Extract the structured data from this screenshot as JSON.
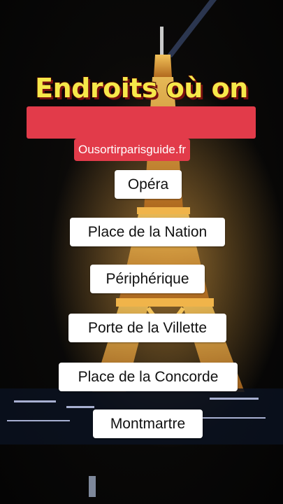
{
  "overlay": {
    "title": "Endroits où on",
    "site": "Ousortirparisguide.fr"
  },
  "places": [
    "Opéra",
    "Place de la Nation",
    "Périphérique",
    "Porte de la Villette",
    "Place de la Concorde",
    "Montmartre"
  ],
  "colors": {
    "title": "#f6e84a",
    "banner": "#e23b4a",
    "label_bg": "#ffffff",
    "tower_lights": "#e8a53a"
  }
}
